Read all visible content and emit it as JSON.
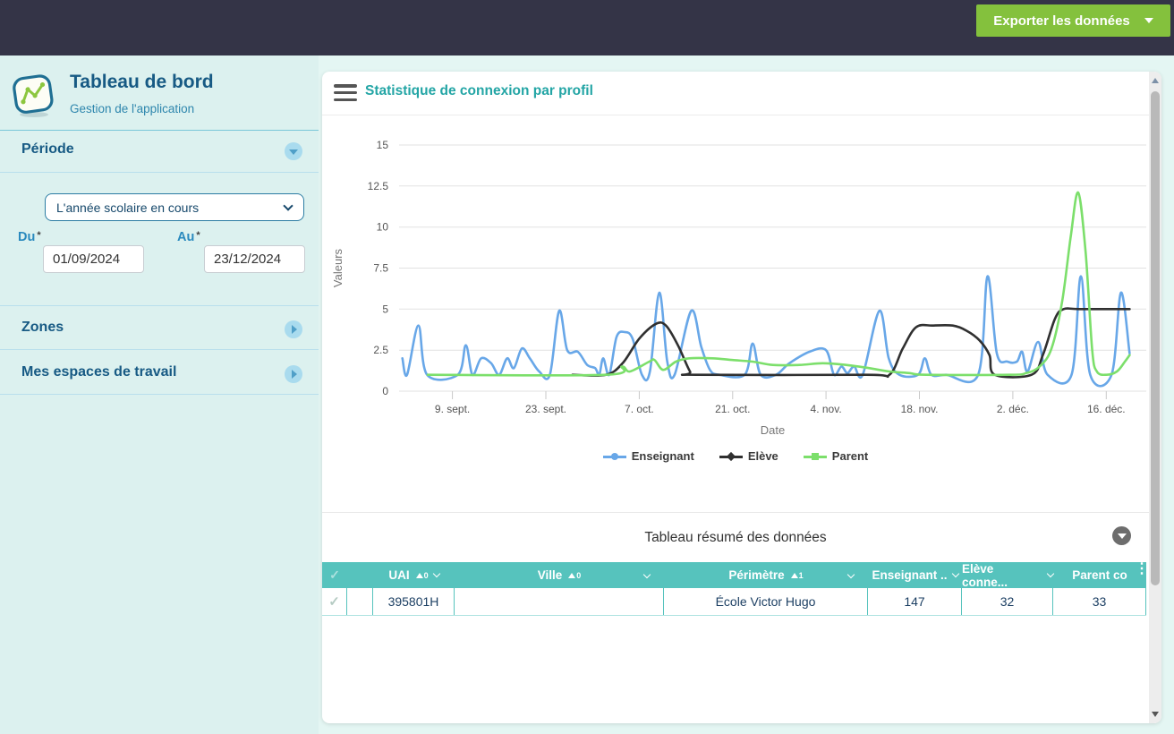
{
  "topbar": {
    "export_label": "Exporter les données"
  },
  "sidebar": {
    "title": "Tableau de bord",
    "subtitle": "Gestion de l'application",
    "sections": {
      "periode": {
        "label": "Période",
        "expanded": true
      },
      "zones": {
        "label": "Zones",
        "expanded": false
      },
      "espaces": {
        "label": "Mes espaces de travail",
        "expanded": false
      }
    },
    "periode_form": {
      "select_value": "L'année scolaire en cours",
      "du_label": "Du",
      "du_value": "01/09/2024",
      "au_label": "Au",
      "au_value": "23/12/2024",
      "required_mark": "*"
    }
  },
  "main": {
    "chart_title": "Statistique de connexion par profil",
    "table_title": "Tableau résumé des données"
  },
  "chart_data": {
    "type": "line",
    "title": "Statistique de connexion par profil",
    "xlabel": "Date",
    "ylabel": "Valeurs",
    "ylim": [
      0,
      15
    ],
    "yticks": [
      0,
      2.5,
      5,
      7.5,
      10,
      12.5,
      15
    ],
    "grid": true,
    "legend_position": "bottom",
    "x_unit": "days since 01/09/2024",
    "xlim": [
      0,
      112
    ],
    "xticks": [
      {
        "d": 8,
        "label": "9. sept."
      },
      {
        "d": 22,
        "label": "23. sept."
      },
      {
        "d": 36,
        "label": "7. oct."
      },
      {
        "d": 50,
        "label": "21. oct."
      },
      {
        "d": 64,
        "label": "4. nov."
      },
      {
        "d": 78,
        "label": "18. nov."
      },
      {
        "d": 92,
        "label": "2. déc."
      },
      {
        "d": 106,
        "label": "16. déc."
      }
    ],
    "series": [
      {
        "name": "Enseignant",
        "color": "#68a7e8",
        "marker": "circle",
        "points": [
          [
            0.5,
            2
          ],
          [
            1.2,
            1
          ],
          [
            2.9,
            4
          ],
          [
            4.2,
            1
          ],
          [
            8.8,
            1
          ],
          [
            10,
            2.8
          ],
          [
            11,
            1
          ],
          [
            12.3,
            2
          ],
          [
            13.8,
            1.7
          ],
          [
            15,
            1
          ],
          [
            16.2,
            2
          ],
          [
            17.2,
            1.4
          ],
          [
            18.4,
            2.6
          ],
          [
            19.6,
            2
          ],
          [
            21,
            1.2
          ],
          [
            22.6,
            1
          ],
          [
            24,
            4.9
          ],
          [
            25.2,
            2.5
          ],
          [
            26.8,
            2.4
          ],
          [
            28.2,
            1.6
          ],
          [
            29.4,
            1.4
          ],
          [
            30,
            1
          ],
          [
            30.6,
            2
          ],
          [
            31.5,
            1
          ],
          [
            32.6,
            3.3
          ],
          [
            33.8,
            3.6
          ],
          [
            35,
            3.2
          ],
          [
            36.4,
            1
          ],
          [
            37.6,
            1.2
          ],
          [
            39,
            6
          ],
          [
            40.2,
            1.8
          ],
          [
            41.3,
            1
          ],
          [
            43.8,
            4.9
          ],
          [
            45.3,
            2.7
          ],
          [
            46.6,
            1.3
          ],
          [
            48,
            1
          ],
          [
            51.8,
            1
          ],
          [
            53,
            2.9
          ],
          [
            54.2,
            1
          ],
          [
            56.5,
            1
          ],
          [
            58.5,
            1.7
          ],
          [
            61.5,
            2.4
          ],
          [
            64,
            2.5
          ],
          [
            65.2,
            1
          ],
          [
            66.3,
            1.5
          ],
          [
            67.2,
            1.1
          ],
          [
            68.2,
            1.5
          ],
          [
            69.5,
            1
          ],
          [
            72,
            4.9
          ],
          [
            73.4,
            2
          ],
          [
            75,
            1
          ],
          [
            77.8,
            1
          ],
          [
            78.8,
            2
          ],
          [
            79.8,
            1
          ],
          [
            82,
            1
          ],
          [
            86.8,
            1
          ],
          [
            88.2,
            7
          ],
          [
            89.6,
            2.3
          ],
          [
            91.2,
            1.8
          ],
          [
            92.6,
            1.8
          ],
          [
            93.4,
            2.4
          ],
          [
            94.2,
            1.2
          ],
          [
            95.8,
            3
          ],
          [
            97.2,
            1
          ],
          [
            100.8,
            1
          ],
          [
            102.2,
            7
          ],
          [
            103.6,
            1
          ],
          [
            106.8,
            1
          ],
          [
            108.2,
            6
          ],
          [
            109.5,
            2.3
          ]
        ]
      },
      {
        "name": "Elève",
        "color": "#303030",
        "marker": "diamond",
        "points": [
          [
            26,
            1
          ],
          [
            31,
            1
          ],
          [
            33.5,
            1.7
          ],
          [
            36,
            3.2
          ],
          [
            38.5,
            4.1
          ],
          [
            40,
            4
          ],
          [
            41.8,
            2.8
          ],
          [
            43.6,
            1.2
          ],
          [
            44.5,
            1
          ],
          [
            70,
            1
          ],
          [
            73.5,
            1
          ],
          [
            75.5,
            2.6
          ],
          [
            77.5,
            3.9
          ],
          [
            80,
            4
          ],
          [
            83,
            4
          ],
          [
            85,
            3.7
          ],
          [
            87,
            3.1
          ],
          [
            88.5,
            2.2
          ],
          [
            89.3,
            1
          ],
          [
            94.8,
            1
          ],
          [
            96.5,
            2.2
          ],
          [
            98.3,
            4.4
          ],
          [
            99.6,
            5
          ],
          [
            102,
            5
          ],
          [
            109.5,
            5
          ]
        ]
      },
      {
        "name": "Parent",
        "color": "#7cdf6b",
        "marker": "square",
        "points": [
          [
            4.3,
            1
          ],
          [
            31,
            1
          ],
          [
            33.4,
            1.5
          ],
          [
            34.6,
            1.2
          ],
          [
            37.5,
            1.8
          ],
          [
            38.3,
            1.9
          ],
          [
            39.6,
            1.3
          ],
          [
            41.5,
            1.8
          ],
          [
            43.5,
            2
          ],
          [
            47,
            2
          ],
          [
            50,
            1.9
          ],
          [
            53,
            1.8
          ],
          [
            56,
            1.6
          ],
          [
            60,
            1.6
          ],
          [
            63.5,
            1.7
          ],
          [
            67,
            1.6
          ],
          [
            70.5,
            1.4
          ],
          [
            73.5,
            1.2
          ],
          [
            76.5,
            1.1
          ],
          [
            79,
            1
          ],
          [
            91.5,
            1
          ],
          [
            94,
            1.1
          ],
          [
            96,
            1.5
          ],
          [
            97.8,
            2.6
          ],
          [
            99.4,
            5.5
          ],
          [
            100.7,
            9.5
          ],
          [
            101.8,
            12.1
          ],
          [
            102.9,
            8.5
          ],
          [
            103.9,
            2.5
          ],
          [
            104.6,
            1.2
          ],
          [
            106,
            1
          ],
          [
            107.6,
            1.2
          ],
          [
            108.8,
            1.8
          ],
          [
            109.5,
            2.2
          ]
        ]
      }
    ]
  },
  "table": {
    "title": "Tableau résumé des données",
    "columns": [
      {
        "label": "UAI",
        "sort": "asc",
        "sort_order": "0",
        "filter": true
      },
      {
        "label": "Ville",
        "sort": "asc",
        "sort_order": "0",
        "filter": true
      },
      {
        "label": "Périmètre",
        "sort": "asc",
        "sort_order": "1",
        "filter": true
      },
      {
        "label": "Enseignant ..",
        "filter": true
      },
      {
        "label": "Elève conne...",
        "filter": true
      },
      {
        "label": "Parent co",
        "filter": false
      }
    ],
    "rows": [
      {
        "selected": true,
        "uai": "395801H",
        "ville": "",
        "perimetre": "École Victor Hugo",
        "enseignant_connecte": "147",
        "eleve_connecte": "32",
        "parent_connecte": "33"
      }
    ]
  },
  "colors": {
    "topbar": "#343447",
    "export_green": "#84c13d",
    "accent_teal": "#56c3bd",
    "sidebar_bg": "#dcf1ef",
    "heading_blue": "#175a84",
    "series_enseignant": "#68a7e8",
    "series_eleve": "#303030",
    "series_parent": "#7cdf6b"
  }
}
